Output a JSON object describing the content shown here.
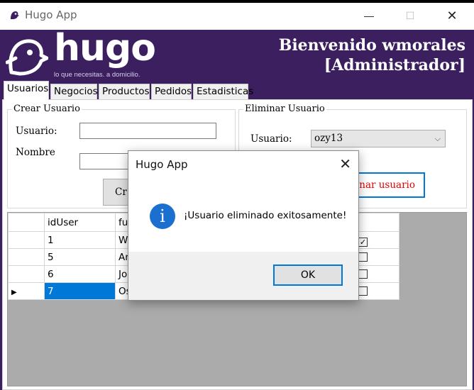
{
  "window": {
    "title": "Hugo App",
    "minimize_glyph": "—",
    "maximize_glyph": "☐",
    "close_glyph": "✕"
  },
  "header": {
    "logo_word": "hugo",
    "tagline": "lo que necesitas. a domicilio.",
    "welcome_line1": "Bienvenido wmorales",
    "welcome_line2": "[Administrador]",
    "bg_color": "#3b1f5f"
  },
  "tabs": [
    {
      "label": "Usuarios",
      "active": true
    },
    {
      "label": "Negocios"
    },
    {
      "label": "Productos"
    },
    {
      "label": "Pedidos"
    },
    {
      "label": "Estadisticas"
    }
  ],
  "create_user": {
    "legend": "Crear Usuario",
    "user_label": "Usuario:",
    "name_label": "Nombre",
    "user_value": "",
    "name_value": "",
    "button_partial": "Cr"
  },
  "delete_user": {
    "legend": "Eliminar Usuario",
    "user_label": "Usuario:",
    "selected": "ozy13",
    "button_partial": "minar usuario"
  },
  "grid": {
    "headers": [
      "idUser",
      "fu",
      "",
      "",
      "ype"
    ],
    "rows": [
      {
        "id": "1",
        "name": "W",
        "checked": true
      },
      {
        "id": "5",
        "name": "Ar",
        "checked": false
      },
      {
        "id": "6",
        "name": "Jo",
        "checked": false
      },
      {
        "id": "7",
        "name": "Os",
        "checked": false,
        "selected": true
      }
    ]
  },
  "dialog": {
    "title": "Hugo App",
    "message": "¡Usuario eliminado exitosamente!",
    "ok_label": "OK",
    "icon": "info-icon",
    "icon_glyph": "i",
    "close_glyph": "✕"
  }
}
